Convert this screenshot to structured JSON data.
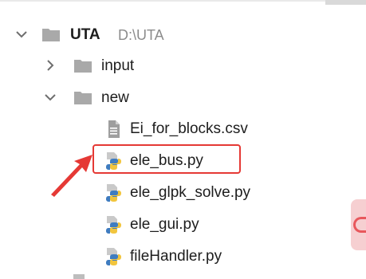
{
  "tree": {
    "root": {
      "name": "UTA",
      "path": "D:\\UTA",
      "icon": "folder-icon",
      "expanded": true
    },
    "folders": [
      {
        "name": "input",
        "icon": "folder-icon",
        "expanded": false
      },
      {
        "name": "new",
        "icon": "folder-icon",
        "expanded": true
      }
    ],
    "files": [
      {
        "name": "Ei_for_blocks.csv",
        "icon": "text-file-icon"
      },
      {
        "name": "ele_bus.py",
        "icon": "python-file-icon",
        "highlighted": true
      },
      {
        "name": "ele_glpk_solve.py",
        "icon": "python-file-icon"
      },
      {
        "name": "ele_gui.py",
        "icon": "python-file-icon"
      },
      {
        "name": "fileHandler.py",
        "icon": "python-file-icon"
      }
    ]
  },
  "colors": {
    "highlight": "#e53935",
    "folder": "#a9a9a9",
    "python_blue": "#3f7cc0",
    "python_yellow": "#f2c53d",
    "text": "#1d1d1d",
    "path_text": "#8c8c8c"
  }
}
